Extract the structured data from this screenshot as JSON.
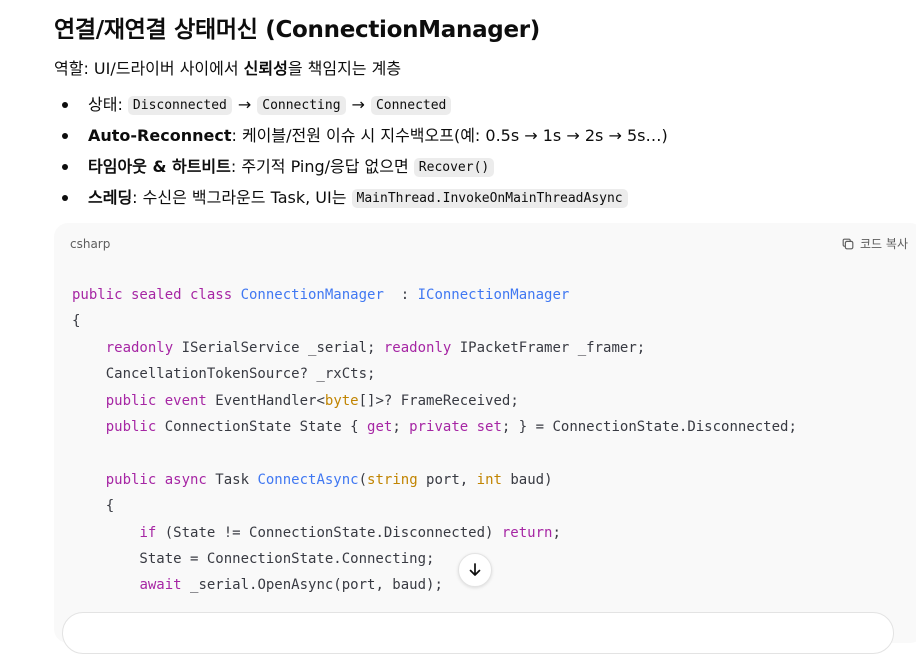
{
  "heading": "연결/재연결 상태머신 (ConnectionManager)",
  "role": {
    "prefix": "역할: UI/드라이버 사이에서 ",
    "bold": "신뢰성",
    "suffix": "을 책임지는 계층"
  },
  "bullets": [
    {
      "label": "상태: ",
      "states": [
        "Disconnected",
        "Connecting",
        "Connected"
      ],
      "arrow": "→"
    },
    {
      "label": "Auto-Reconnect",
      "text": ": 케이블/전원 이슈 시 지수백오프(예: 0.5s → 1s → 2s → 5s…)"
    },
    {
      "label": "타임아웃 & 하트비트",
      "text": ": 주기적 Ping/응답 없으면 ",
      "code": "Recover()"
    },
    {
      "label": "스레딩",
      "text": ": 수신은 백그라운드 Task, UI는 ",
      "code": "MainThread.InvokeOnMainThreadAsync"
    }
  ],
  "codeblock": {
    "language": "csharp",
    "copy_label": "코드 복사",
    "lines": [
      [
        [
          "kw",
          "public sealed class "
        ],
        [
          "ty",
          "ConnectionManager"
        ],
        [
          "",
          "  : "
        ],
        [
          "ty",
          "IConnectionManager"
        ]
      ],
      [
        [
          "",
          "{"
        ]
      ],
      [
        [
          "",
          "    "
        ],
        [
          "kw",
          "readonly"
        ],
        [
          "",
          " ISerialService _serial; "
        ],
        [
          "kw",
          "readonly"
        ],
        [
          "",
          " IPacketFramer _framer;"
        ]
      ],
      [
        [
          "",
          "    CancellationTokenSource? _rxCts;"
        ]
      ],
      [
        [
          "",
          "    "
        ],
        [
          "kw",
          "public event"
        ],
        [
          "",
          " EventHandler<"
        ],
        [
          "pr",
          "byte"
        ],
        [
          "",
          "[]>? FrameReceived;"
        ]
      ],
      [
        [
          "",
          "    "
        ],
        [
          "kw",
          "public"
        ],
        [
          "",
          " ConnectionState State { "
        ],
        [
          "kw",
          "get"
        ],
        [
          "",
          "; "
        ],
        [
          "kw",
          "private set"
        ],
        [
          "",
          "; } = ConnectionState.Disconnected;"
        ]
      ],
      [
        [
          "",
          ""
        ]
      ],
      [
        [
          "",
          "    "
        ],
        [
          "kw",
          "public async"
        ],
        [
          "",
          " Task "
        ],
        [
          "fn",
          "ConnectAsync"
        ],
        [
          "",
          "("
        ],
        [
          "pr",
          "string"
        ],
        [
          "",
          " port, "
        ],
        [
          "pr",
          "int"
        ],
        [
          "",
          " baud)"
        ]
      ],
      [
        [
          "",
          "    {"
        ]
      ],
      [
        [
          "",
          "        "
        ],
        [
          "kw",
          "if"
        ],
        [
          "",
          " (State != ConnectionState.Disconnected) "
        ],
        [
          "kw",
          "return"
        ],
        [
          "",
          ";"
        ]
      ],
      [
        [
          "",
          "        State = ConnectionState.Connecting;"
        ]
      ],
      [
        [
          "",
          "        "
        ],
        [
          "kw",
          "await"
        ],
        [
          "",
          " _serial.OpenAsync(port, baud);"
        ]
      ]
    ]
  },
  "icons": {
    "copy": "copy-icon",
    "scroll": "arrow-down-icon"
  }
}
